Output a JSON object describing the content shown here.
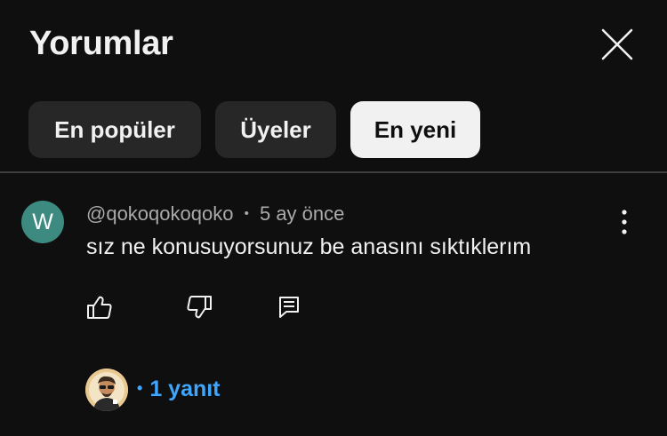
{
  "header": {
    "title": "Yorumlar"
  },
  "filters": [
    {
      "label": "En popüler",
      "selected": false
    },
    {
      "label": "Üyeler",
      "selected": false
    },
    {
      "label": "En yeni",
      "selected": true
    }
  ],
  "comment": {
    "avatar_letter": "W",
    "avatar_color": "#3c8a80",
    "author": "@qokoqokoqoko",
    "separator": "•",
    "time": "5 ay önce",
    "text": "sız ne konusuyorsunuz be anasını sıktıklerım",
    "replies_bullet": "•",
    "replies_label": "1 yanıt"
  },
  "icons": [
    "close-icon",
    "more-vert-icon",
    "thumbs-up-icon",
    "thumbs-down-icon",
    "reply-icon"
  ],
  "colors": {
    "background": "#0f0f0f",
    "chip": "#272727",
    "chip_selected": "#f1f1f1",
    "link": "#3ea6ff"
  }
}
